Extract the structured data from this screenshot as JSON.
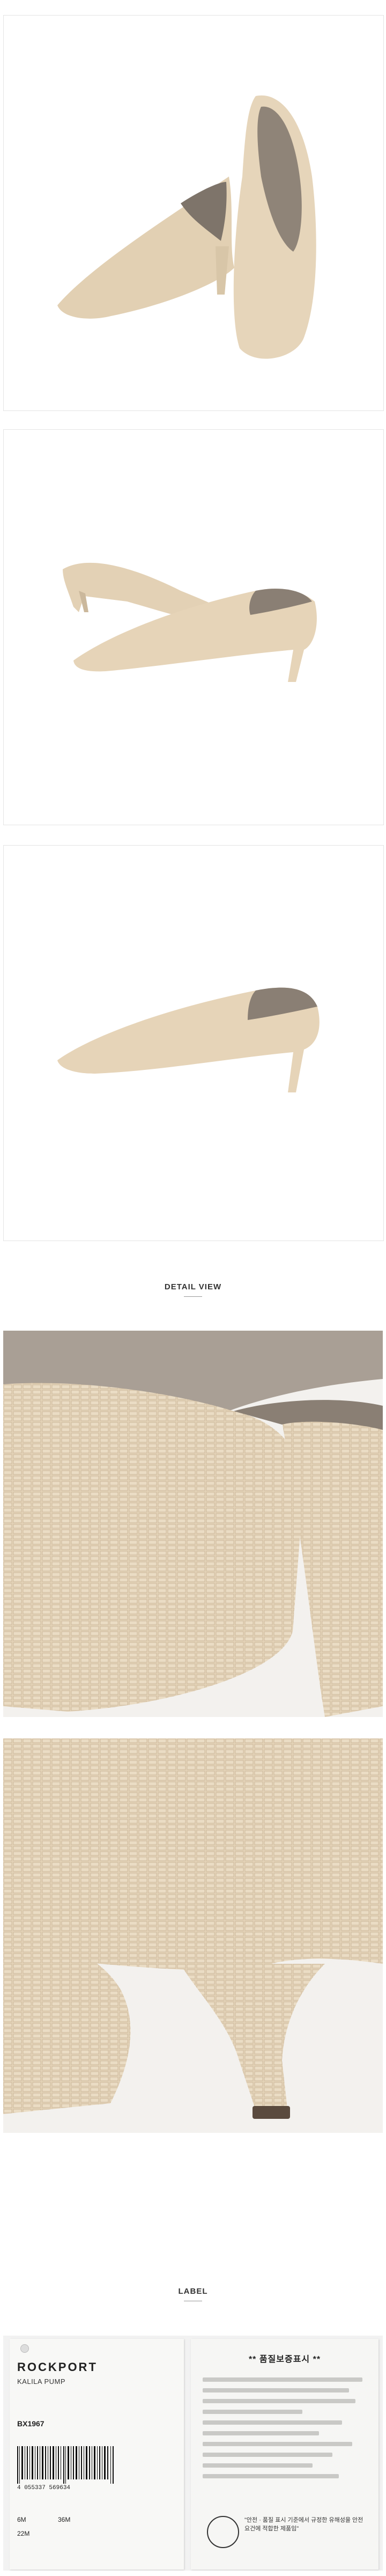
{
  "sections": {
    "detail_view": "DETAIL VIEW",
    "label": "LABEL"
  },
  "hangtag": {
    "brand": "ROCKPORT",
    "model": "KALILA PUMP",
    "code": "BX1967",
    "barcode_number": "4 055337 569634",
    "size_us": "6M",
    "size_uk": "36M",
    "size_eu": "22M"
  },
  "quality_card": {
    "title": "** 품질보증표시 **",
    "kc_text": "\"안전 · 품질 표시 기준에서 규정한 유해성을 안전요건에 적합한 제품임\""
  },
  "colors": {
    "shoe_base": "#e4d3b8",
    "shoe_shadow": "#c8b496",
    "lining": "#8a7f74",
    "sole": "#5a4a3e"
  }
}
